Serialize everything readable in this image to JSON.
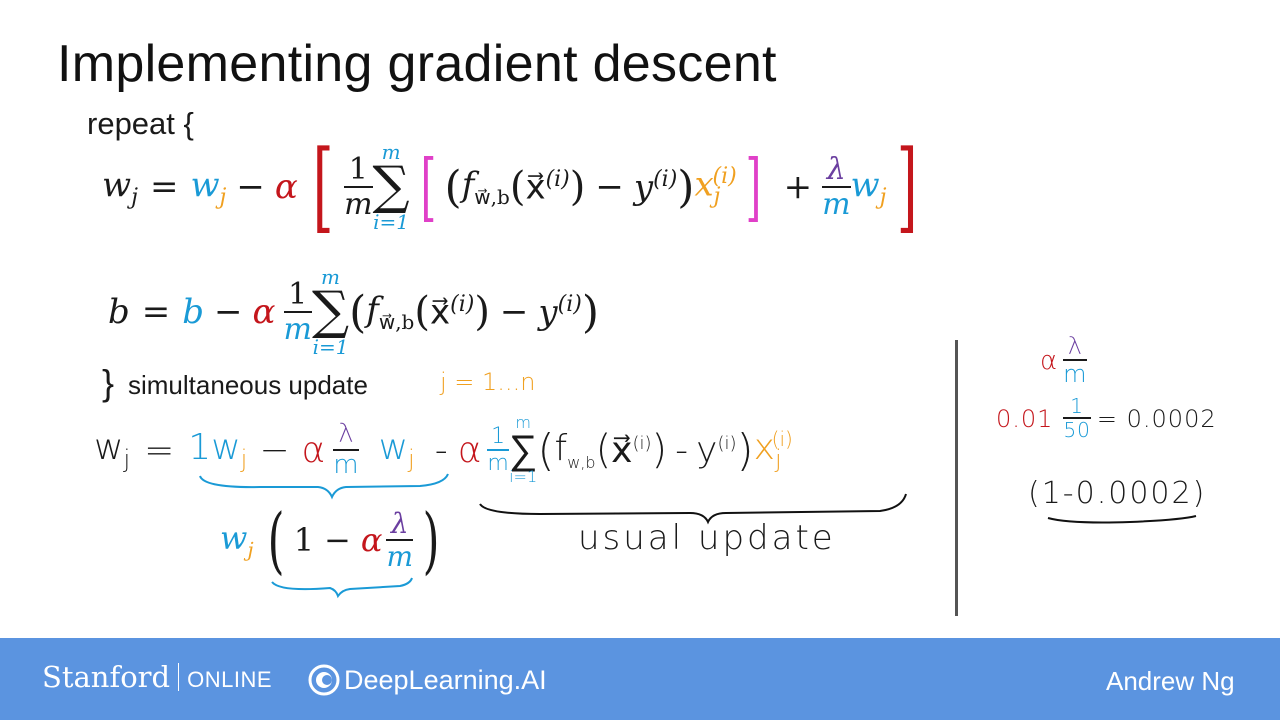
{
  "slide": {
    "title": "Implementing gradient descent"
  },
  "equations": {
    "repeat": "repeat {",
    "w_update": {
      "lhs": "w",
      "lhs_sub": "j",
      "eq": "=",
      "w": "w",
      "w_sub": "j",
      "minus": "−",
      "alpha": "α",
      "frac_num": "1",
      "frac_den": "m",
      "sum_top": "m",
      "sum_bot": "i=1",
      "f": "f",
      "f_sub": "w⃗,b",
      "x": "x⃗",
      "x_sup": "(i)",
      "y": "y",
      "y_sup": "(i)",
      "xj": "x",
      "xj_sub": "j",
      "xj_sup": "(i)",
      "plus": "+",
      "lambda": "λ",
      "m": "m",
      "wj": "w",
      "wj_sub": "j"
    },
    "b_update": {
      "lhs": "b",
      "eq": "=",
      "b": "b",
      "minus": "−",
      "alpha": "α",
      "frac_num": "1",
      "frac_den": "m",
      "sum_top": "m",
      "sum_bot": "i=1",
      "f": "f",
      "f_sub": "w⃗,b",
      "x": "x⃗",
      "x_sup": "(i)",
      "y": "y",
      "y_sup": "(i)"
    },
    "close": "}",
    "simultaneous": "simultaneous update",
    "j_range": "j = 1...n"
  },
  "handwritten": {
    "row": {
      "wj": "w",
      "wj_sub": "j",
      "eq": "=",
      "one": "1",
      "w": "w",
      "w_sub": "j",
      "minus": "−",
      "alpha": "α",
      "lambda": "λ",
      "m": "m",
      "w2": "w",
      "w2_sub": "j",
      "minus2": "-",
      "alpha2": "α",
      "frac_num": "1",
      "frac_den": "m",
      "sum_top": "m",
      "sum_bot": "i=1",
      "f": "f",
      "f_sub": "w,b",
      "x": "x⃗",
      "x_sup": "(i)",
      "y": "y",
      "y_sup": "(i)",
      "xj": "x",
      "xj_sub": "j",
      "xj_sup": "(i)"
    },
    "factored": {
      "w": "w",
      "w_sub": "j",
      "open": "(",
      "one": "1",
      "minus": "−",
      "alpha": "α",
      "lambda": "λ",
      "m": "m",
      "close": ")"
    },
    "usual_update": "usual update",
    "side": {
      "alpha": "α",
      "lambda": "λ",
      "m": "m",
      "value": "0.01",
      "frac_num": "1",
      "frac_den": "50",
      "result": "= 0.0002",
      "factor": "(1-0.0002)"
    }
  },
  "footer": {
    "stanford": "Stanford",
    "online": "ONLINE",
    "deeplearning": "DeepLearning.AI",
    "author": "Andrew Ng"
  },
  "colors": {
    "footer_bg": "#5b94e0",
    "blue": "#1a9ad6",
    "orange": "#f0a020",
    "red": "#c4161c",
    "magenta": "#e040c8",
    "purple": "#6b3fa0"
  }
}
